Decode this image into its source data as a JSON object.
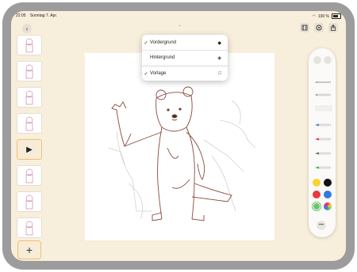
{
  "status_bar": {
    "time": "22:05",
    "date": "Sonntag 7. Apr.",
    "battery": "100 %"
  },
  "menu": {
    "items": [
      {
        "label": "Vordergrund",
        "checked": true,
        "icon": "layers-up-icon"
      },
      {
        "label": "Hintergrund",
        "checked": false,
        "icon": "layers-down-icon"
      },
      {
        "label": "Vorlage",
        "checked": true,
        "icon": "square-icon"
      }
    ],
    "check_glyph": "✓"
  },
  "frames": {
    "count": 8,
    "play_label": "▶",
    "add_label": "+"
  },
  "palette": {
    "colors": [
      "#f7d430",
      "#111111",
      "#e83a40",
      "#2f7de1",
      "#6cc46a",
      "rainbow"
    ],
    "tools": [
      "pencil",
      "pen",
      "eraser",
      "marker-blue",
      "marker-red",
      "marker-gray",
      "marker-green"
    ],
    "more_label": "•••"
  },
  "icons": {
    "back": "‹",
    "handle": "⌃",
    "film": "film-icon",
    "share": "share-icon",
    "circle": "circle-icon"
  }
}
